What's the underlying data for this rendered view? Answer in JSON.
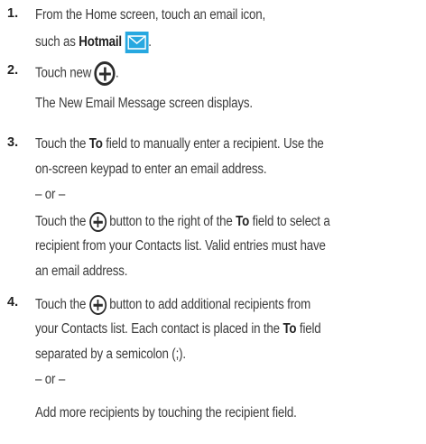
{
  "colors": {
    "text": "#3c3c3c",
    "bold": "#222222",
    "hotmail_icon": "#27a8e0"
  },
  "step1": {
    "number": "1.",
    "line1": "From the Home screen, touch an email icon,",
    "line2_pre": "such as ",
    "line2_bold": "Hotmail",
    "line2_post": ".",
    "icon": "hotmail-envelope-icon"
  },
  "step2": {
    "number": "2.",
    "line1_pre": "Touch new",
    "line1_post": ".",
    "icon": "plus-circle-icon",
    "line2": "The New Email Message screen displays."
  },
  "step3": {
    "number": "3.",
    "line1_pre": "Touch the ",
    "line1_bold": "To",
    "line1_post": " field to manually enter a recipient. Use the",
    "line2": "on-screen keypad to enter an email address.",
    "or": "– or –",
    "line4_pre": "Touch the",
    "line4_mid": "button to the right of the ",
    "line4_bold": "To",
    "line4_post": " field to select a",
    "line5": "recipient from your Contacts list. Valid entries must have",
    "line6": "an email address."
  },
  "step4": {
    "number": "4.",
    "line1_pre": "Touch the",
    "line1_post": "button to add additional recipients from",
    "line2_pre": "your Contacts list. Each contact is placed in the ",
    "line2_bold": "To",
    "line2_post": " field",
    "line3": "separated by a semicolon (;).",
    "or": "– or –",
    "line5": "Add more recipients by touching the recipient field."
  }
}
